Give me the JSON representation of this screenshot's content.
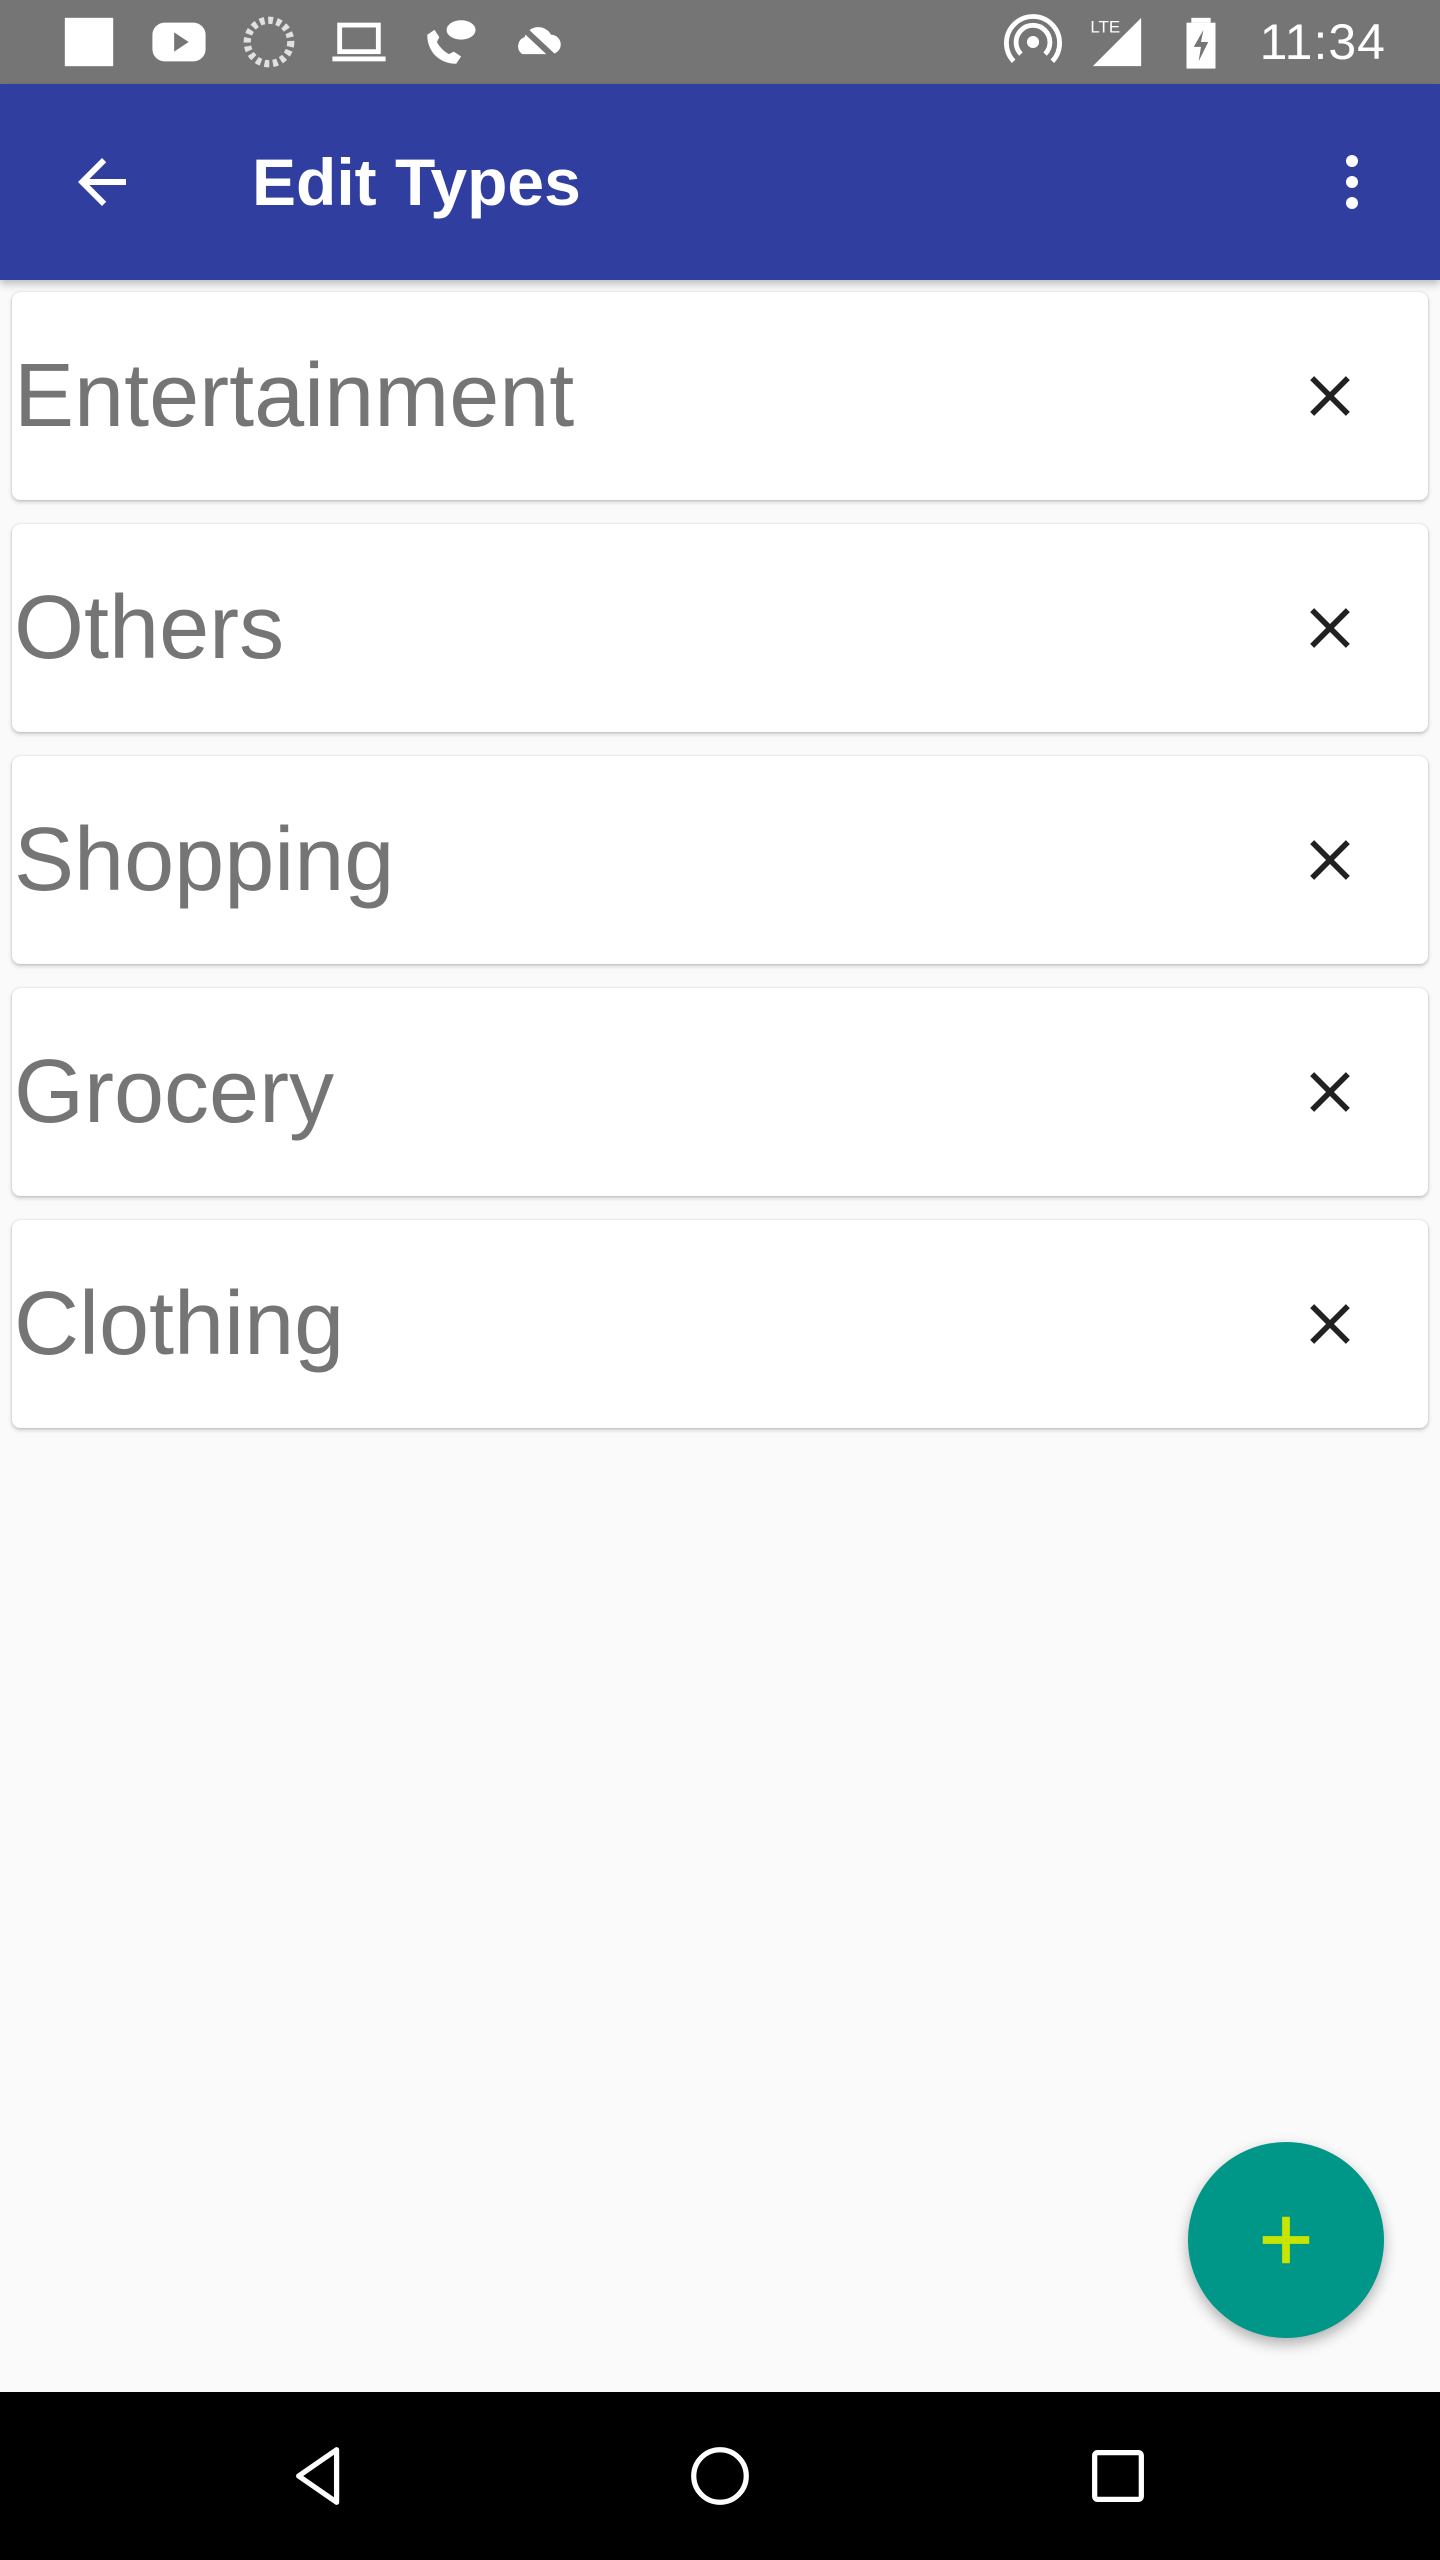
{
  "status_bar": {
    "time": "11:34",
    "left_icons": [
      "notification-square-icon",
      "youtube-icon",
      "sync-icon",
      "laptop-icon",
      "missed-call-icon",
      "cloud-off-icon"
    ],
    "right_icons": [
      "hotspot-icon",
      "lte-signal-icon",
      "battery-charging-icon"
    ],
    "network_label": "LTE"
  },
  "app_bar": {
    "title": "Edit Types",
    "background_color": "#303f9f"
  },
  "types": [
    {
      "label": "Entertainment"
    },
    {
      "label": "Others"
    },
    {
      "label": "Shopping"
    },
    {
      "label": "Grocery"
    },
    {
      "label": "Clothing"
    }
  ],
  "fab": {
    "icon": "plus-icon",
    "background_color": "#009688",
    "icon_color": "#c6e500"
  },
  "nav_bar": {
    "buttons": [
      "back-triangle-icon",
      "home-circle-icon",
      "recents-square-icon"
    ]
  }
}
